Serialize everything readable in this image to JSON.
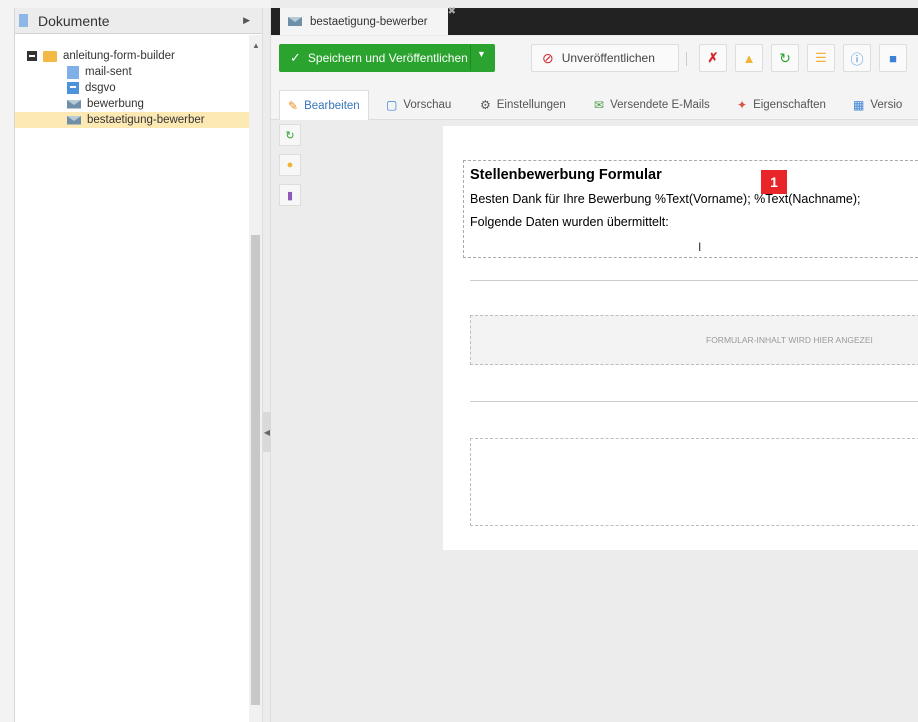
{
  "left_panel": {
    "title": "Dokumente",
    "tree": [
      {
        "label": "anleitung-form-builder",
        "icon": "folder-icon"
      },
      {
        "label": "mail-sent",
        "icon": "document-icon"
      },
      {
        "label": "dsgvo",
        "icon": "snippet-icon"
      },
      {
        "label": "bewerbung",
        "icon": "email-icon"
      },
      {
        "label": "bestaetigung-bewerber",
        "icon": "email-icon",
        "selected": true
      }
    ]
  },
  "document_tab": {
    "label": "bestaetigung-bewerber"
  },
  "toolbar": {
    "save_label": "Speichern und Veröffentlichen",
    "unpublish_label": "Unveröffentlichen"
  },
  "edit_tabs": [
    {
      "label": "Bearbeiten",
      "icon": "pencil-icon",
      "active": true
    },
    {
      "label": "Vorschau",
      "icon": "preview-icon"
    },
    {
      "label": "Einstellungen",
      "icon": "gear-icon"
    },
    {
      "label": "Versendete E-Mails",
      "icon": "email-sent-icon"
    },
    {
      "label": "Eigenschaften",
      "icon": "properties-icon"
    },
    {
      "label": "Versio",
      "icon": "versions-icon"
    }
  ],
  "editor": {
    "title": "Stellenbewerbung Formular",
    "line1": "Besten Dank für Ihre Bewerbung %Text(Vorname); %Text(Nachname);",
    "line2": "Folgende Daten wurden übermittelt:",
    "badge": "1",
    "form_placeholder": "FORMULAR-INHALT WIRD HIER ANGEZEI"
  },
  "colors": {
    "accent_green": "#2aa32f",
    "badge_red": "#e8262a",
    "selected_row": "#fde9b4"
  }
}
